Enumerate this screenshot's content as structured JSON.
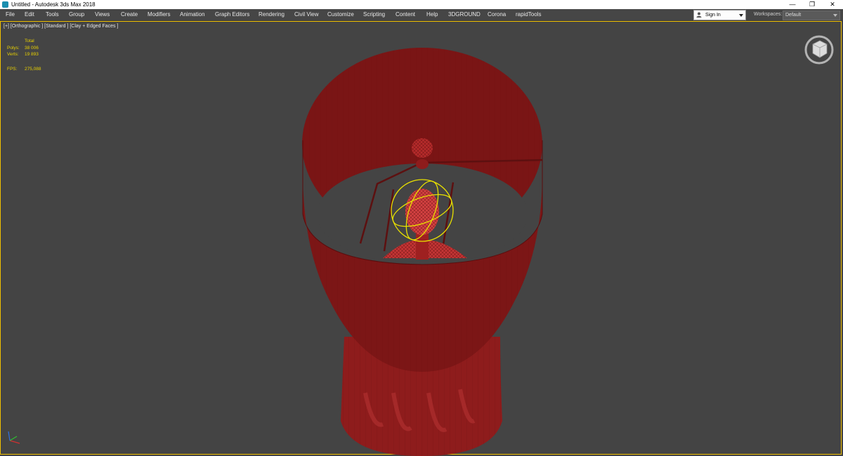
{
  "window": {
    "title": "Untitled - Autodesk 3ds Max 2018",
    "controls": [
      "—",
      "❐",
      "✕"
    ]
  },
  "menu": {
    "items": [
      "File",
      "Edit",
      "Tools",
      "Group",
      "Views",
      "Create",
      "Modifiers",
      "Animation",
      "Graph Editors",
      "Rendering",
      "Civil View",
      "Customize",
      "Scripting",
      "Content",
      "Help",
      "3DGROUND",
      "Corona",
      "rapidTools"
    ]
  },
  "account": {
    "signin_label": "Sign In"
  },
  "workspaces": {
    "label": "Workspaces:",
    "value": "Default"
  },
  "viewport": {
    "label": "[+] [Orthographic ] [Standard ] [Clay + Edged Faces ]",
    "stats": {
      "header": "Total",
      "polys_label": "Polys:",
      "polys_value": "38 006",
      "verts_label": "Verts:",
      "verts_value": "19 893",
      "fps_label": "FPS:",
      "fps_value": "275,088"
    }
  },
  "colors": {
    "viewport_bg": "#444444",
    "selection_border": "#f0c000",
    "model_red": "#8b1a1a",
    "gizmo_yellow": "#e8e000",
    "stats_text": "#e8d000"
  },
  "icons": {
    "viewcube": "viewcube-icon",
    "axis_tripod": "axis-tripod-icon",
    "app": "3dsmax-app-icon"
  }
}
